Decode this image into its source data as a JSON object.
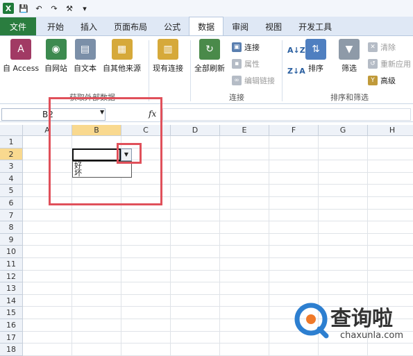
{
  "qat": {
    "logo": "X"
  },
  "tabs": [
    "文件",
    "开始",
    "插入",
    "页面布局",
    "公式",
    "数据",
    "审阅",
    "视图",
    "开发工具"
  ],
  "active_tab": "数据",
  "ribbon": {
    "get_external": {
      "label": "获取外部数据",
      "buttons": [
        "自 Access",
        "自网站",
        "自文本",
        "自其他来源"
      ]
    },
    "existing_conn": "现有连接",
    "connections": {
      "label": "连接",
      "refresh_all": "全部刷新",
      "items": [
        "连接",
        "属性",
        "编辑链接"
      ]
    },
    "sort_filter": {
      "label": "排序和筛选",
      "sort": "排序",
      "filter": "筛选",
      "items": [
        "清除",
        "重新应用",
        "高级"
      ]
    }
  },
  "formula_bar": {
    "name_box": "B2",
    "fx": "fx"
  },
  "columns": [
    "A",
    "B",
    "C",
    "D",
    "E",
    "F",
    "G",
    "H"
  ],
  "rows": [
    "1",
    "2",
    "3",
    "4",
    "5",
    "6",
    "7",
    "8",
    "9",
    "10",
    "11",
    "12",
    "13",
    "14",
    "15",
    "16",
    "17",
    "18"
  ],
  "dropdown_options": [
    "好",
    "坏"
  ],
  "watermark": {
    "brand": "查询啦",
    "url": "chaxunla.com"
  }
}
